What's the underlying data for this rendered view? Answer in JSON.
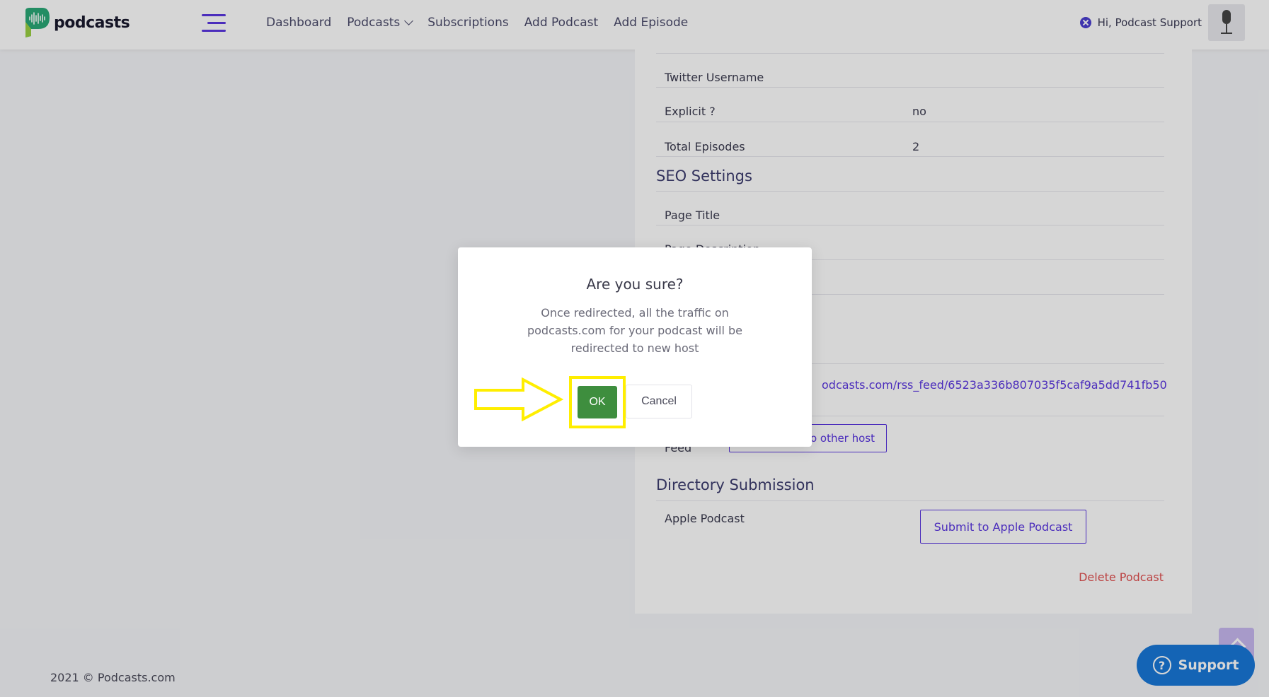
{
  "header": {
    "brand": "podcasts",
    "nav": [
      "Dashboard",
      "Podcasts",
      "Subscriptions",
      "Add Podcast",
      "Add Episode"
    ],
    "user_greeting": "Hi, Podcast Support"
  },
  "details": {
    "rows": [
      {
        "label": "Twitter Username",
        "value": ""
      },
      {
        "label": "Explicit ?",
        "value": "no"
      },
      {
        "label": "Total Episodes",
        "value": "2"
      }
    ],
    "seo_title": "SEO Settings",
    "seo_rows": [
      "Page Title",
      "Page Description"
    ],
    "rss_partial": "odcasts.com/rss_feed/6523a336b807035f5caf9a5dd741fb50",
    "feed_label": "Feed",
    "redirect_button_partial": "to other host",
    "directory_title": "Directory Submission",
    "apple_label": "Apple Podcast",
    "apple_button": "Submit to Apple Podcast",
    "delete_label": "Delete Podcast"
  },
  "footer": {
    "copyright": "2021 © Podcasts.com"
  },
  "support_label": "Support",
  "modal": {
    "title": "Are you sure?",
    "text": "Once redirected, all the traffic on podcasts.com for your podcast will be redirected to new host",
    "ok_label": "OK",
    "cancel_label": "Cancel"
  },
  "colors": {
    "accent": "#5a36e0",
    "ok": "#3e8e3e",
    "highlight": "#ffee00",
    "danger": "#e05050",
    "support": "#1878d8"
  }
}
